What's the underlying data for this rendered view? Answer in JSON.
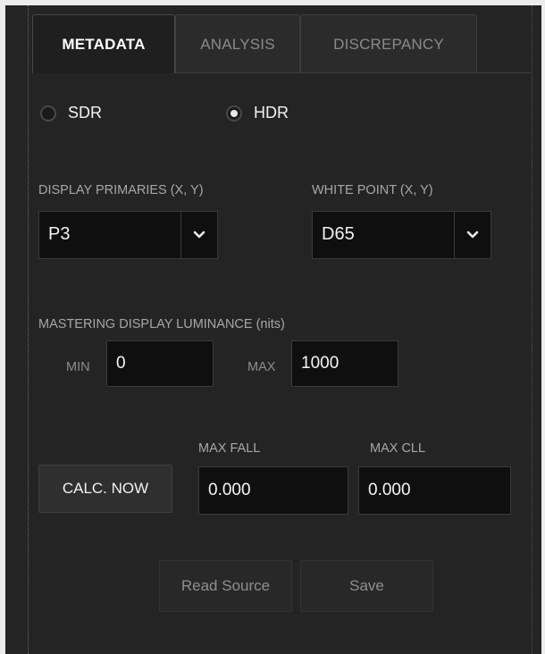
{
  "tabs": [
    {
      "label": "METADATA",
      "active": true
    },
    {
      "label": "ANALYSIS",
      "active": false
    },
    {
      "label": "DISCREPANCY",
      "active": false
    }
  ],
  "mode": {
    "sdr_label": "SDR",
    "hdr_label": "HDR",
    "selected": "HDR"
  },
  "display_primaries": {
    "label": "DISPLAY PRIMARIES (X, Y)",
    "value": "P3"
  },
  "white_point": {
    "label": "WHITE POINT (X, Y)",
    "value": "D65"
  },
  "luminance": {
    "label": "MASTERING DISPLAY LUMINANCE (nits)",
    "min_label": "MIN",
    "min_value": "0",
    "max_label": "MAX",
    "max_value": "1000"
  },
  "light_levels": {
    "calc_button": "CALC. NOW",
    "max_fall_label": "MAX FALL",
    "max_fall_value": "0.000",
    "max_cll_label": "MAX CLL",
    "max_cll_value": "0.000"
  },
  "actions": {
    "read_source": "Read Source",
    "save": "Save"
  },
  "colors": {
    "panel_bg": "#242424",
    "field_bg": "#0f0f0f",
    "text": "#f2f2f2",
    "muted_text": "#a7a7a7"
  }
}
